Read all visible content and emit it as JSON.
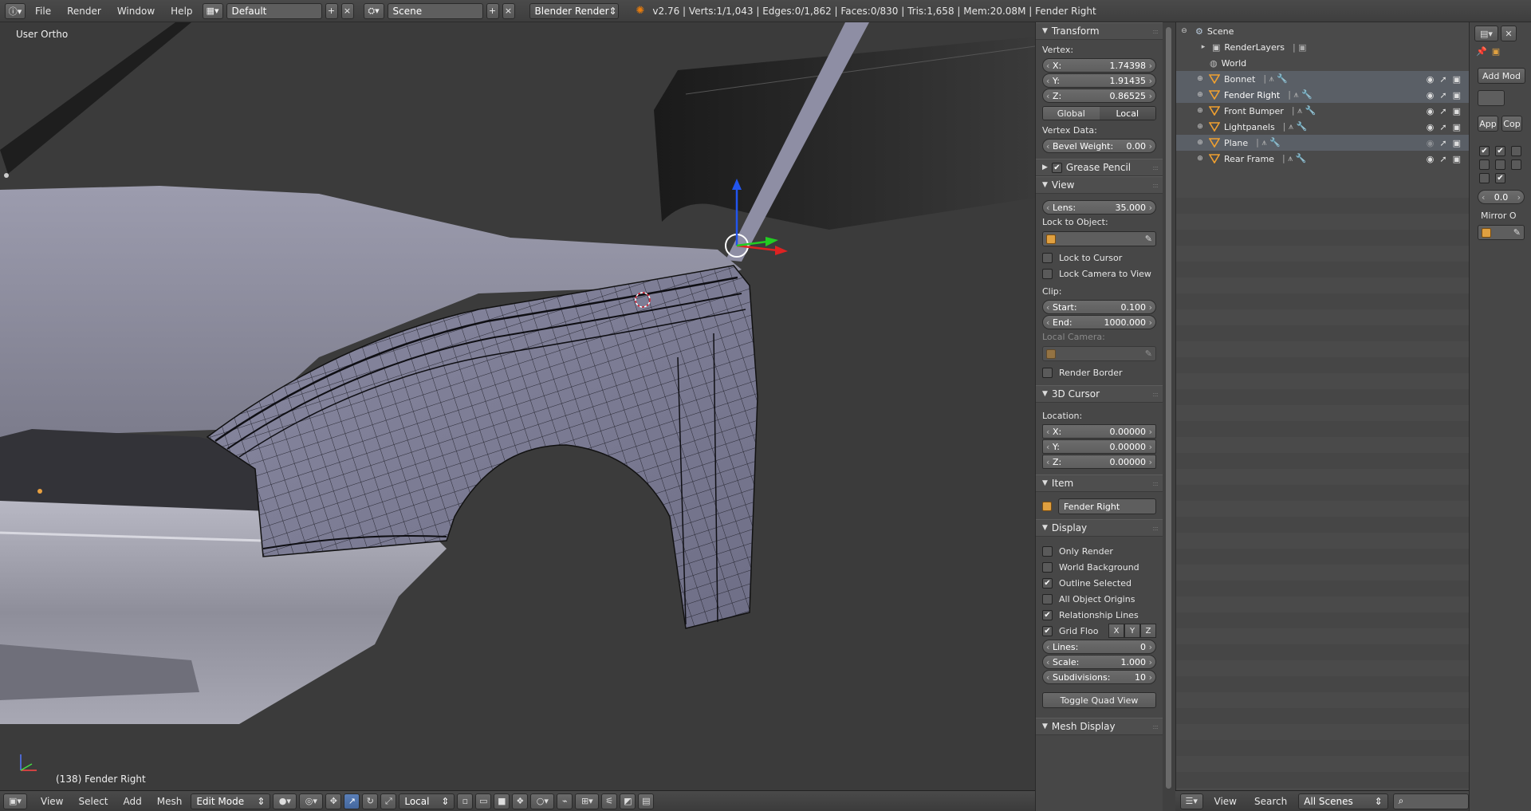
{
  "topbar": {
    "info_icon": "info-icon",
    "menus": [
      "File",
      "Render",
      "Window",
      "Help"
    ],
    "layout_value": "Default",
    "scene_value": "Scene",
    "engine_value": "Blender Render",
    "stats": "v2.76 | Verts:1/1,043 | Edges:0/1,862 | Faces:0/830 | Tris:1,658 | Mem:20.08M | Fender Right"
  },
  "viewport": {
    "view_label": "User Ortho",
    "object_label": "(138) Fender Right"
  },
  "viewport_header": {
    "menus": [
      "View",
      "Select",
      "Add",
      "Mesh"
    ],
    "mode": "Edit Mode",
    "orientation": "Local"
  },
  "npanel": {
    "transform": {
      "title": "Transform",
      "vertex_label": "Vertex:",
      "x_label": "X:",
      "x_value": "1.74398",
      "y_label": "Y:",
      "y_value": "1.91435",
      "z_label": "Z:",
      "z_value": "0.86525",
      "global_label": "Global",
      "local_label": "Local",
      "vertex_data_label": "Vertex Data:",
      "bevel_label": "Bevel Weight:",
      "bevel_value": "0.00"
    },
    "grease_pencil_title": "Grease Pencil",
    "view": {
      "title": "View",
      "lens_label": "Lens:",
      "lens_value": "35.000",
      "lock_object_label": "Lock to Object:",
      "lock_cursor_label": "Lock to Cursor",
      "lock_camera_label": "Lock Camera to View",
      "clip_label": "Clip:",
      "start_label": "Start:",
      "start_value": "0.100",
      "end_label": "End:",
      "end_value": "1000.000",
      "local_camera_label": "Local Camera:",
      "render_border_label": "Render Border"
    },
    "cursor": {
      "title": "3D Cursor",
      "location_label": "Location:",
      "x_label": "X:",
      "x_value": "0.00000",
      "y_label": "Y:",
      "y_value": "0.00000",
      "z_label": "Z:",
      "z_value": "0.00000"
    },
    "item": {
      "title": "Item",
      "name": "Fender Right"
    },
    "display": {
      "title": "Display",
      "only_render": "Only Render",
      "world_background": "World Background",
      "outline_selected": "Outline Selected",
      "all_object_origins": "All Object Origins",
      "relationship_lines": "Relationship Lines",
      "grid_floor": "Grid Floo",
      "axis_x": "X",
      "axis_y": "Y",
      "axis_z": "Z",
      "lines_label": "Lines:",
      "lines_value": "0",
      "scale_label": "Scale:",
      "scale_value": "1.000",
      "subdiv_label": "Subdivisions:",
      "subdiv_value": "10",
      "toggle_quad": "Toggle Quad View"
    },
    "mesh_display_title": "Mesh Display"
  },
  "outliner": {
    "scene": "Scene",
    "render_layers": "RenderLayers",
    "world": "World",
    "objects": [
      {
        "name": "Bonnet"
      },
      {
        "name": "Fender Right"
      },
      {
        "name": "Front Bumper"
      },
      {
        "name": "Lightpanels"
      },
      {
        "name": "Plane"
      },
      {
        "name": "Rear Frame"
      }
    ],
    "header_menus": [
      "View",
      "Search"
    ],
    "scenes_dropdown": "All Scenes"
  },
  "props": {
    "add_modifier": "Add Mod",
    "apply_label": "App",
    "copy_label": "Cop",
    "value": "0.0",
    "mirror_label": "Mirror O"
  },
  "colors": {
    "accent_blue": "#5a7fb8",
    "object_orange": "#e0a040",
    "background": "#3b3b3b"
  }
}
